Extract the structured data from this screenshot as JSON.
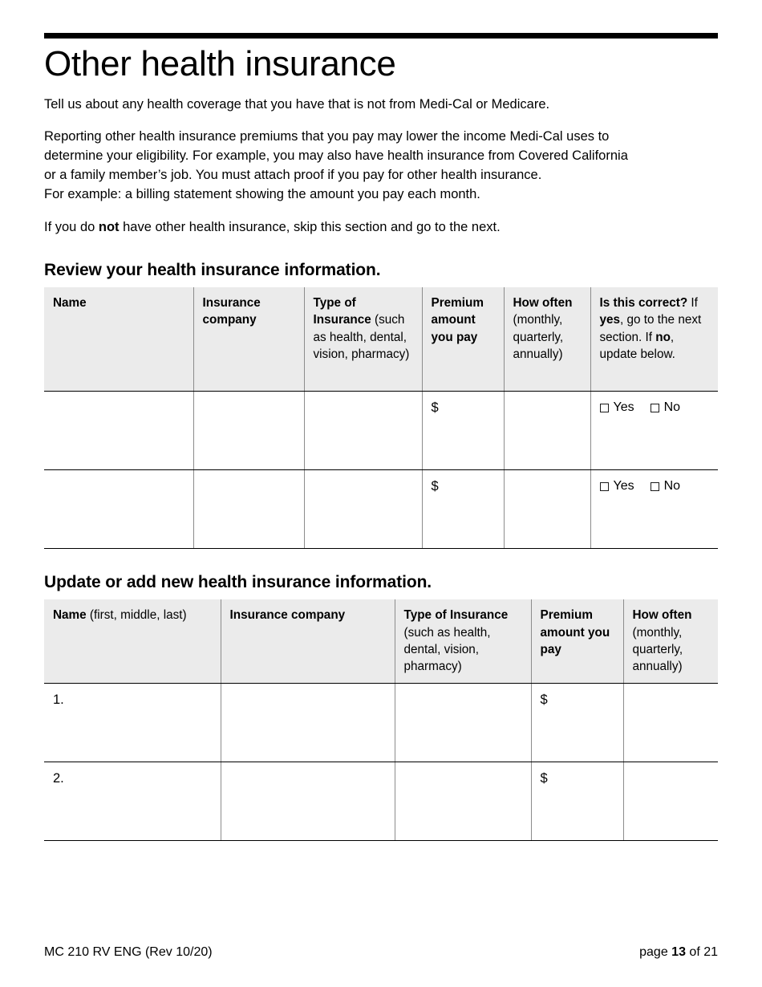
{
  "document": {
    "title": "Other health insurance",
    "intro": "Tell us about any health coverage that you have that is not from Medi-Cal or Medicare.",
    "body_paragraph_lines": [
      "Reporting other health insurance premiums that you pay may lower the income Medi-Cal uses to",
      "determine your eligibility. For example, you may also have health insurance from Covered California",
      "or a family member’s job. You must attach proof if you pay for other health insurance.",
      "For example: a billing statement showing the amount you pay each month."
    ],
    "skip_note": {
      "before": "If you do ",
      "emphasis": "not",
      "after": " have other health insurance, skip this section and go to the next."
    }
  },
  "review_section": {
    "heading": "Review your health insurance information.",
    "columns": [
      {
        "label": "Name",
        "sub": ""
      },
      {
        "label": "Insurance company",
        "sub": ""
      },
      {
        "label": "Type of Insurance",
        "sub": "(such as health, dental, vision, pharmacy)"
      },
      {
        "label": "Premium amount you pay",
        "sub": ""
      },
      {
        "label": "How often",
        "sub": "(monthly, quarterly, annually)"
      },
      {
        "label": "Is this correct?",
        "sub_parts": [
          {
            "text": "If ",
            "bold": false
          },
          {
            "text": "yes",
            "bold": true
          },
          {
            "text": ", go to the next section.",
            "bold": false
          },
          {
            "text": "If ",
            "bold": false,
            "newline": true
          },
          {
            "text": "no",
            "bold": true
          },
          {
            "text": ", update below.",
            "bold": false
          }
        ]
      }
    ],
    "rows": [
      {
        "name": "",
        "insurance_company": "",
        "type_of_insurance": "",
        "premium_amount": "$",
        "how_often": "",
        "choices": [
          {
            "label": "Yes",
            "checked": false
          },
          {
            "label": "No",
            "checked": false
          }
        ]
      },
      {
        "name": "",
        "insurance_company": "",
        "type_of_insurance": "",
        "premium_amount": "$",
        "how_often": "",
        "choices": [
          {
            "label": "Yes",
            "checked": false
          },
          {
            "label": "No",
            "checked": false
          }
        ]
      }
    ]
  },
  "update_section": {
    "heading": "Update or add new health insurance information.",
    "columns": [
      {
        "label": "Name",
        "sub": " (first, middle, last)"
      },
      {
        "label": "Insurance company",
        "sub": ""
      },
      {
        "label": "Type of Insurance",
        "sub": "(such as health, dental, vision, pharmacy)"
      },
      {
        "label": "Premium amount you pay",
        "sub": ""
      },
      {
        "label": "How often",
        "sub": "(monthly, quarterly, annually)"
      }
    ],
    "rows": [
      {
        "number": "1.",
        "name": "",
        "insurance_company": "",
        "type_of_insurance": "",
        "premium_amount": "$",
        "how_often": ""
      },
      {
        "number": "2.",
        "name": "",
        "insurance_company": "",
        "type_of_insurance": "",
        "premium_amount": "$",
        "how_often": ""
      }
    ]
  },
  "footer": {
    "form_id": "MC 210 RV ENG (Rev 10/20)",
    "page_prefix": "page ",
    "page_number": "13",
    "page_suffix": " of 21"
  }
}
